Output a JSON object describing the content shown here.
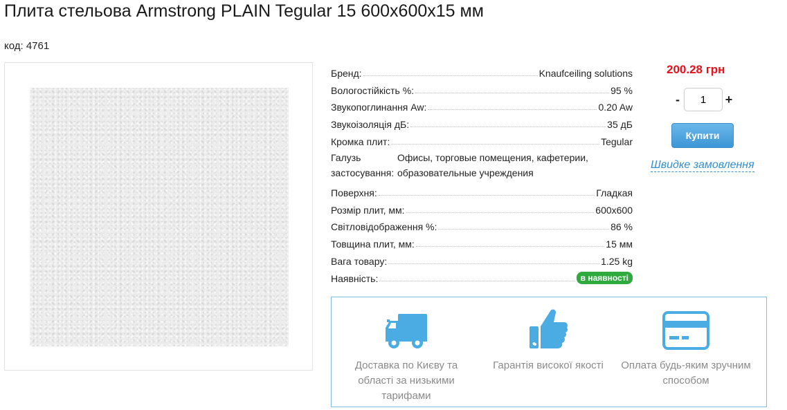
{
  "product": {
    "title": "Плита стельова Armstrong PLAIN Tegular 15 600x600x15 мм",
    "sku_label": "код: 4761"
  },
  "specs": [
    {
      "label": "Бренд:",
      "value": "Knaufceiling solutions"
    },
    {
      "label": "Вологостійкість %:",
      "value": "95 %"
    },
    {
      "label": "Звукопоглинання Aw:",
      "value": "0.20 Aw"
    },
    {
      "label": "Звукоізоляція дБ:",
      "value": "35 дБ"
    },
    {
      "label": "Кромка плит:",
      "value": "Tegular"
    },
    {
      "label": "Галузь застосування:",
      "value": "Офисы, торговые помещения, кафетерии, образовательные учреждения"
    },
    {
      "label": "Поверхня:",
      "value": "Гладкая"
    },
    {
      "label": "Розмір плит, мм:",
      "value": "600x600"
    },
    {
      "label": "Світловідображення %:",
      "value": "86 %"
    },
    {
      "label": "Товщина плит, мм:",
      "value": "15 мм"
    },
    {
      "label": "Вага товару:",
      "value": "1.25 kg"
    },
    {
      "label": "Наявність:",
      "value": "в наявності"
    }
  ],
  "purchase": {
    "price": "200.28 грн",
    "qty_minus": "-",
    "qty_value": "1",
    "qty_plus": "+",
    "buy_label": "Купити",
    "quick_order_label": "Швидке замовлення"
  },
  "benefits": [
    {
      "icon": "delivery-truck-icon",
      "text": "Доставка по Києву та області за низькими тарифами"
    },
    {
      "icon": "thumbs-up-icon",
      "text": "Гарантія високої якості"
    },
    {
      "icon": "credit-card-icon",
      "text": "Оплата будь-яким зручним способом"
    }
  ],
  "colors": {
    "price": "#e8101a",
    "accent_blue": "#3c96d6",
    "in_stock_green": "#2faa3f",
    "icon_blue": "#4aace2"
  }
}
